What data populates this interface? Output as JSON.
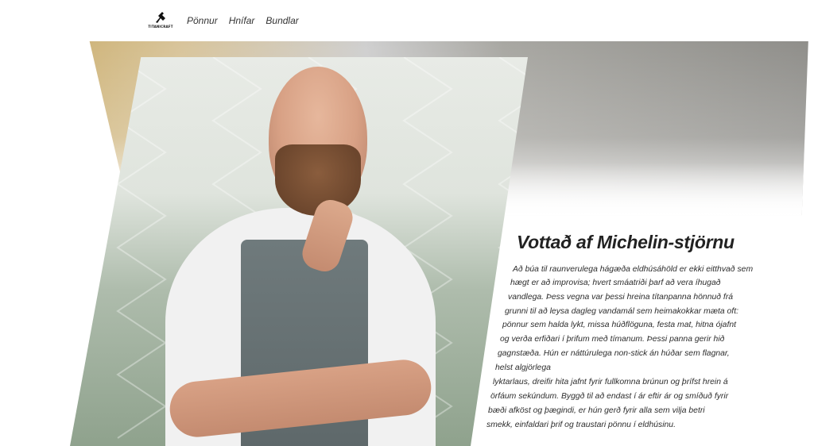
{
  "header": {
    "logo_text": "TITANICRAFT",
    "nav": [
      {
        "label": "Pönnur"
      },
      {
        "label": "Hnífar"
      },
      {
        "label": "Bundlar"
      }
    ]
  },
  "hero": {
    "image_alt": "Kokkur í svuntu",
    "title": "Vottað af Michelin-stjörnu",
    "body_lines": [
      "Að búa til raunverulega hágæða eldhúsáhöld er ekki eitthvað sem",
      "hægt er að improvisa; hvert smáatriði þarf að vera íhugað",
      "vandlega. Þess vegna var þessi hreina títanpanna hönnuð frá",
      "grunni til að leysa dagleg vandamál sem heimakokkar mæta oft:",
      "pönnur sem halda lykt, missa húðflöguna, festa mat, hitna ójafnt",
      "og verða erfiðari í þrifum með tímanum. Þessi panna gerir hið",
      "gagnstæða. Hún er náttúrulega non-stick án húðar sem flagnar,",
      "helst algjörlega",
      "lyktarlaus, dreifir hita jafnt fyrir fullkomna brúnun og þrífst hrein á",
      "örfáum sekúndum. Byggð til að endast í ár eftir ár og smíðuð fyrir",
      "bæði afköst og þægindi, er hún gerð fyrir alla sem vilja betri",
      "smekk, einfaldari þrif og traustari pönnu í eldhúsinu."
    ]
  },
  "colors": {
    "band_gold": "#c7a861",
    "band_grey": "#8f8e8a",
    "text": "#222222"
  }
}
